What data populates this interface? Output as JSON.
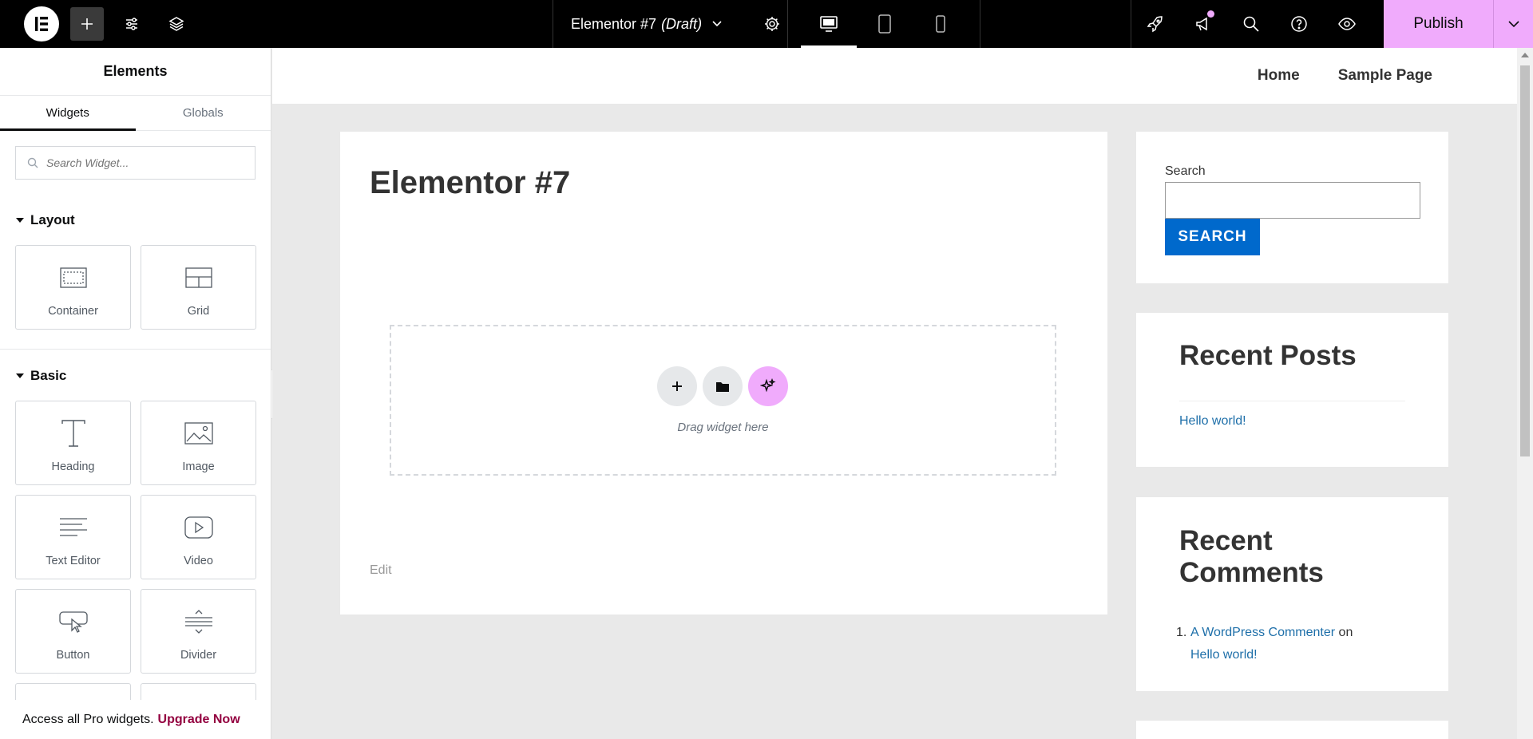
{
  "topbar": {
    "add_label": "+",
    "document": {
      "name": "Elementor #7",
      "status": "(Draft)"
    },
    "publish_label": "Publish"
  },
  "sidebar": {
    "title": "Elements",
    "tabs": [
      {
        "label": "Widgets"
      },
      {
        "label": "Globals"
      }
    ],
    "search_placeholder": "Search Widget...",
    "categories": [
      {
        "label": "Layout",
        "widgets": [
          "Container",
          "Grid"
        ]
      },
      {
        "label": "Basic",
        "widgets": [
          "Heading",
          "Image",
          "Text Editor",
          "Video",
          "Button",
          "Divider"
        ]
      }
    ],
    "footer": {
      "text": "Access all Pro widgets.",
      "link": "Upgrade Now"
    }
  },
  "canvas": {
    "nav": [
      "Home",
      "Sample Page"
    ],
    "post_title": "Elementor #7",
    "dropzone_text": "Drag widget here",
    "edit_label": "Edit",
    "search_widget": {
      "label": "Search",
      "button": "SEARCH"
    },
    "recent_posts": {
      "title": "Recent Posts",
      "items": [
        "Hello world!"
      ]
    },
    "recent_comments": {
      "title": "Recent Comments",
      "item": {
        "number": "1.",
        "author": "A WordPress Commenter",
        "connector": "on",
        "post": "Hello world!"
      }
    }
  },
  "colors": {
    "accent_pink": "#f0abfc",
    "link_blue": "#1e6fa9",
    "search_button_blue": "#0069cc",
    "upgrade_link": "#93003f"
  }
}
